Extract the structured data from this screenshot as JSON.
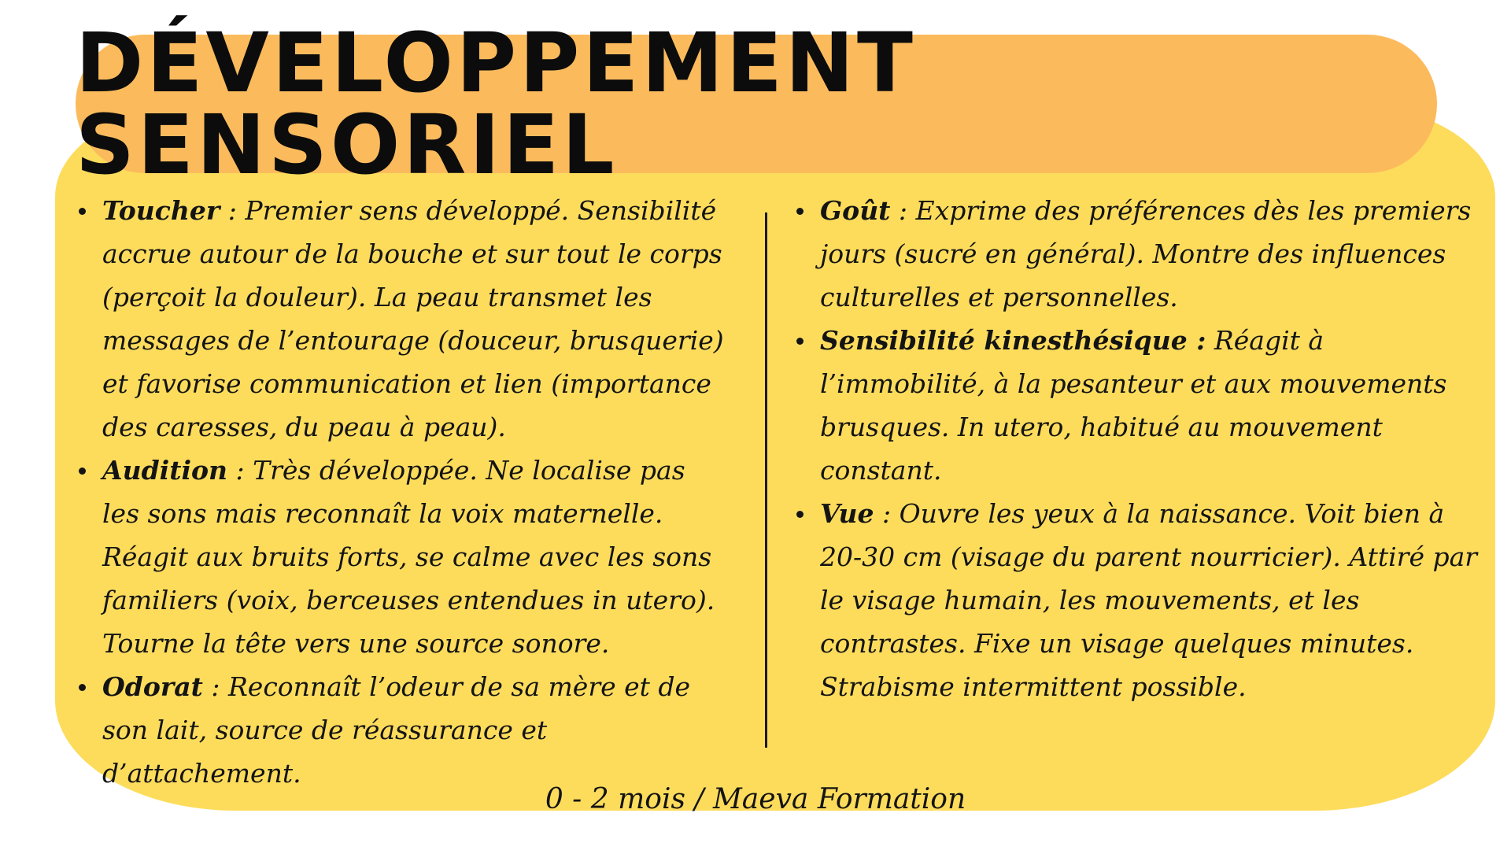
{
  "title": "DÉVELOPPEMENT SENSORIEL",
  "left_items": [
    {
      "term": "Toucher",
      "sep": " : ",
      "text": "Premier sens développé. Sensibilité accrue autour de la bouche et sur tout le corps (perçoit la douleur). La peau transmet les messages de l’entourage (douceur, brusquerie) et favorise communication et lien (importance des caresses, du peau à peau)."
    },
    {
      "term": "Audition",
      "sep": " : ",
      "text": "Très développée. Ne localise pas les sons mais reconnaît la voix maternelle. Réagit aux bruits forts, se calme avec les sons familiers (voix, berceuses entendues in utero). Tourne la tête vers une source sonore."
    },
    {
      "term": "Odorat",
      "sep": " : ",
      "text": "Reconnaît l’odeur de sa mère et de son lait, source de réassurance et d’attachement."
    }
  ],
  "right_items": [
    {
      "term": "Goût",
      "sep": " : ",
      "text": "Exprime des préférences dès les premiers jours (sucré en général). Montre des influences culturelles et personnelles."
    },
    {
      "term": "Sensibilité kinesthésique :",
      "sep": " ",
      "text": "Réagit à l’immobilité, à la pesanteur et aux mouvements brusques. In utero, habitué au mouvement constant."
    },
    {
      "term": "Vue",
      "sep": " : ",
      "text": "Ouvre les yeux à la naissance. Voit bien à 20-30 cm (visage du parent nourricier). Attiré par le visage humain, les mouvements, et les contrastes. Fixe un visage quelques minutes. Strabisme intermittent possible."
    }
  ],
  "footer": "0 - 2 mois / Maeva Formation",
  "colors": {
    "card": "#fddc5c",
    "title_pill": "#fbbb5c",
    "text": "#141414"
  }
}
